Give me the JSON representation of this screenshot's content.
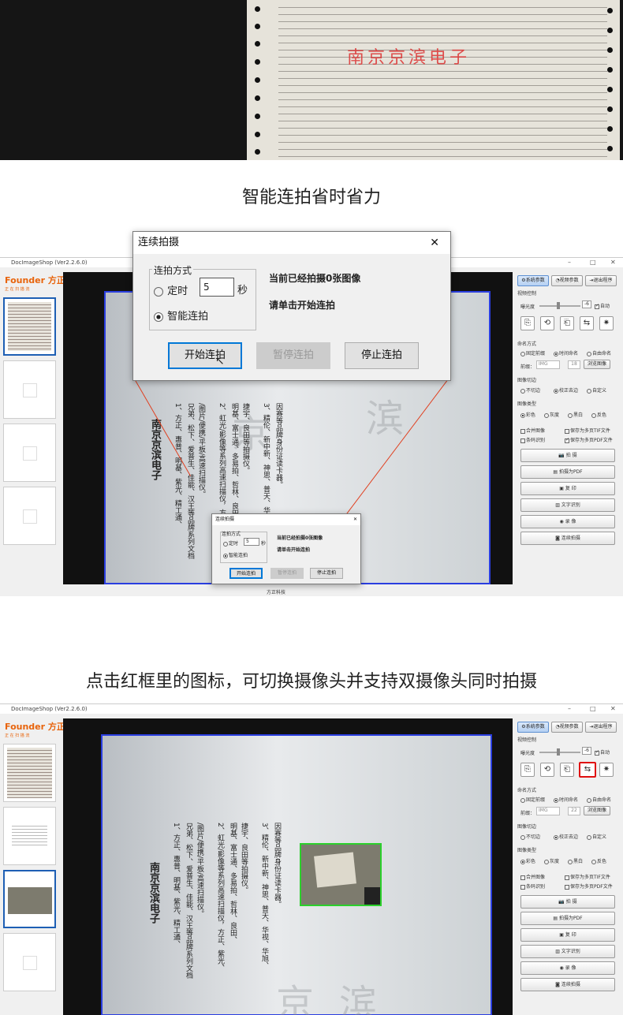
{
  "caption1": "智能连拍省时省力",
  "caption2": "点击红框里的图标，可切换摄像头并支持双摄像头同时拍摄",
  "paper_stamp": "南京京滨电子",
  "app": {
    "title": "DocImageShop (Ver2.2.6.0)",
    "logo": "Founder 方正",
    "logo_sub": "正 在 扫 描 流",
    "footer": "方正科技",
    "doc_title": "南京京滨电子",
    "doc_lines": [
      "1、方正、惠普、明基、紫光、精工通、",
      "兄弟、松下、爱普生、佳能、汉王等品牌系列文档",
      "/图片/便携/平板/高速扫描仪。",
      "2、虹光/影像等系列高速扫描仪，方正、紫光、",
      "明基、富士通、多易拍、哲林、良田、",
      "捷宇、良田等拍摄仪。",
      "3、精伦、新中新、神思、普天、华视、华旭、",
      "因赛等品牌身份证读卡器。"
    ],
    "watermark1": "京",
    "watermark2": "滨",
    "panel": {
      "tab1": "系统参数",
      "tab2": "视频参数",
      "tab3": "退出程序",
      "video_ctrl": "视频控制",
      "exposure": "曝光度",
      "exposure_val": "-6",
      "auto": "自动",
      "naming": "命名方式",
      "fixed": "固定前缀",
      "time": "时间命名",
      "custom": "自由命名",
      "prefix_label": "前缀：",
      "prefix_val": "IMG",
      "seq1": "18",
      "seq2": "22",
      "browse": "浏览图像",
      "crop": "图像切边",
      "nocrop": "不切边",
      "deskew": "校正去边",
      "customcrop": "自定义",
      "imgtype": "图像类型",
      "color": "彩色",
      "gray": "灰度",
      "bw": "黑白",
      "invert": "反色",
      "merge": "合并图像",
      "save_tif": "保存为多页TIF文件",
      "barcode": "条码识别",
      "save_pdf": "保存为多页PDF文件",
      "actions": [
        "拍  摄",
        "拍摄为PDF",
        "复  印",
        "文字识别",
        "录  像",
        "连续拍摄"
      ]
    }
  },
  "dialog": {
    "title": "连续拍摄",
    "group": "连拍方式",
    "timed": "定时",
    "interval": "5",
    "sec": "秒",
    "smart": "智能连拍",
    "status1": "当前已经拍摄0张图像",
    "status2": "请单击开始连拍",
    "start": "开始连拍",
    "pause": "暂停连拍",
    "stop": "停止连拍",
    "close": "✕"
  }
}
